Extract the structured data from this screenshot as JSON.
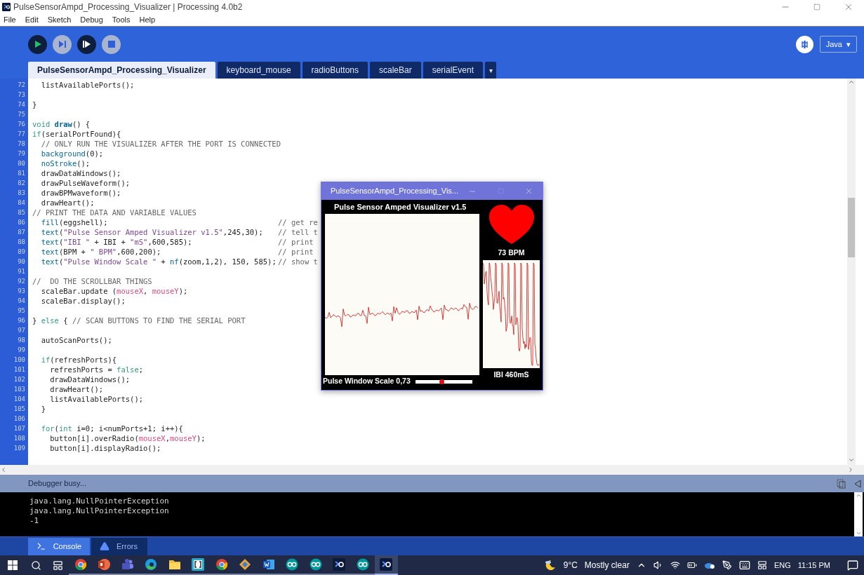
{
  "window": {
    "title": "PulseSensorAmpd_Processing_Visualizer | Processing 4.0b2"
  },
  "menu": [
    "File",
    "Edit",
    "Sketch",
    "Debug",
    "Tools",
    "Help"
  ],
  "toolbar": {
    "buttons": [
      {
        "kind": "run",
        "disabled": false
      },
      {
        "kind": "step",
        "disabled": true
      },
      {
        "kind": "continue",
        "disabled": false
      },
      {
        "kind": "stop",
        "disabled": true
      }
    ],
    "mode": {
      "label": "Java",
      "caret": "▾"
    }
  },
  "tabs": [
    {
      "label": "PulseSensorAmpd_Processing_Visualizer",
      "selected": true
    },
    {
      "label": "keyboard_mouse",
      "selected": false
    },
    {
      "label": "radioButtons",
      "selected": false
    },
    {
      "label": "scaleBar",
      "selected": false
    },
    {
      "label": "serialEvent",
      "selected": false
    }
  ],
  "tabs_menu": "▾",
  "editor": {
    "lines": [
      {
        "number": "72",
        "code": [
          {
            "text": "  listAvailablePorts();",
            "kind": "plain"
          }
        ]
      },
      {
        "number": "73"
      },
      {
        "number": "74",
        "code": [
          {
            "text": "}",
            "kind": "plain"
          }
        ]
      },
      {
        "number": "75"
      },
      {
        "number": "76",
        "code": [
          {
            "text": "void ",
            "kind": "keyword"
          },
          {
            "text": "draw",
            "kind": "bold"
          },
          {
            "text": "() {",
            "kind": "plain"
          }
        ]
      },
      {
        "number": "77",
        "code": [
          {
            "text": "if",
            "kind": "keyword"
          },
          {
            "text": "(serialPortFound){",
            "kind": "plain"
          }
        ]
      },
      {
        "number": "78",
        "code": [
          {
            "text": "  // ONLY RUN THE VISUALIZER AFTER THE PORT IS CONNECTED",
            "kind": "comment"
          }
        ]
      },
      {
        "number": "79",
        "code": [
          {
            "text": "  background",
            "kind": "function"
          },
          {
            "text": "(0);",
            "kind": "plain"
          }
        ]
      },
      {
        "number": "80",
        "code": [
          {
            "text": "  noStroke",
            "kind": "function"
          },
          {
            "text": "();",
            "kind": "plain"
          }
        ]
      },
      {
        "number": "81",
        "code": [
          {
            "text": "  drawDataWindows();",
            "kind": "plain"
          }
        ]
      },
      {
        "number": "82",
        "code": [
          {
            "text": "  drawPulseWaveform();",
            "kind": "plain"
          }
        ]
      },
      {
        "number": "83",
        "code": [
          {
            "text": "  drawBPMwaveform();",
            "kind": "plain"
          }
        ]
      },
      {
        "number": "84",
        "code": [
          {
            "text": "  drawHeart();",
            "kind": "plain"
          }
        ]
      },
      {
        "number": "85",
        "code": [
          {
            "text": "// PRINT THE DATA AND VARIABLE VALUES",
            "kind": "comment"
          }
        ]
      },
      {
        "number": "86",
        "code": [
          {
            "text": "  fill",
            "kind": "function"
          },
          {
            "text": "(eggshell);",
            "kind": "plain"
          }
        ],
        "note": "// get re"
      },
      {
        "number": "87",
        "code": [
          {
            "text": "  text",
            "kind": "function"
          },
          {
            "text": "(",
            "kind": "plain"
          },
          {
            "text": "\"Pulse Sensor Amped Visualizer v1.5\"",
            "kind": "string"
          },
          {
            "text": ",245,30);",
            "kind": "plain"
          }
        ],
        "note": "// tell t"
      },
      {
        "number": "88",
        "code": [
          {
            "text": "  text",
            "kind": "function"
          },
          {
            "text": "(",
            "kind": "plain"
          },
          {
            "text": "\"IBI \"",
            "kind": "string"
          },
          {
            "text": " + IBI + ",
            "kind": "plain"
          },
          {
            "text": "\"mS\"",
            "kind": "string"
          },
          {
            "text": ",600,585);",
            "kind": "plain"
          }
        ],
        "note": "// print"
      },
      {
        "number": "89",
        "code": [
          {
            "text": "  text",
            "kind": "function"
          },
          {
            "text": "(BPM + ",
            "kind": "plain"
          },
          {
            "text": "\" BPM\"",
            "kind": "string"
          },
          {
            "text": ",600,200);",
            "kind": "plain"
          }
        ],
        "note": "// print"
      },
      {
        "number": "90",
        "code": [
          {
            "text": "  text",
            "kind": "function"
          },
          {
            "text": "(",
            "kind": "plain"
          },
          {
            "text": "\"Pulse Window Scale \"",
            "kind": "string"
          },
          {
            "text": " + ",
            "kind": "plain"
          },
          {
            "text": "nf",
            "kind": "function"
          },
          {
            "text": "(zoom,1,2), 150, 585);",
            "kind": "plain"
          }
        ],
        "note": "// show t"
      },
      {
        "number": "91"
      },
      {
        "number": "92",
        "code": [
          {
            "text": "//  DO THE SCROLLBAR THINGS",
            "kind": "comment"
          }
        ]
      },
      {
        "number": "93",
        "code": [
          {
            "text": "  scaleBar.update (",
            "kind": "plain"
          },
          {
            "text": "mouseX",
            "kind": "variable"
          },
          {
            "text": ", ",
            "kind": "plain"
          },
          {
            "text": "mouseY",
            "kind": "variable"
          },
          {
            "text": ");",
            "kind": "plain"
          }
        ]
      },
      {
        "number": "94",
        "code": [
          {
            "text": "  scaleBar.display();",
            "kind": "plain"
          }
        ]
      },
      {
        "number": "95"
      },
      {
        "number": "96",
        "code": [
          {
            "text": "} ",
            "kind": "plain"
          },
          {
            "text": "else",
            "kind": "keyword"
          },
          {
            "text": " { ",
            "kind": "plain"
          },
          {
            "text": "// SCAN BUTTONS TO FIND THE SERIAL PORT",
            "kind": "comment"
          }
        ]
      },
      {
        "number": "97"
      },
      {
        "number": "98",
        "code": [
          {
            "text": "  autoScanPorts();",
            "kind": "plain"
          }
        ]
      },
      {
        "number": "99"
      },
      {
        "number": "100",
        "code": [
          {
            "text": "  if",
            "kind": "keyword"
          },
          {
            "text": "(refreshPorts){",
            "kind": "plain"
          }
        ]
      },
      {
        "number": "101",
        "code": [
          {
            "text": "    refreshPorts = ",
            "kind": "plain"
          },
          {
            "text": "false",
            "kind": "keyword"
          },
          {
            "text": ";",
            "kind": "plain"
          }
        ]
      },
      {
        "number": "102",
        "code": [
          {
            "text": "    drawDataWindows();",
            "kind": "plain"
          }
        ]
      },
      {
        "number": "103",
        "code": [
          {
            "text": "    drawHeart();",
            "kind": "plain"
          }
        ]
      },
      {
        "number": "104",
        "code": [
          {
            "text": "    listAvailablePorts();",
            "kind": "plain"
          }
        ]
      },
      {
        "number": "105",
        "code": [
          {
            "text": "  }",
            "kind": "plain"
          }
        ]
      },
      {
        "number": "106"
      },
      {
        "number": "107",
        "code": [
          {
            "text": "  for",
            "kind": "keyword"
          },
          {
            "text": "(",
            "kind": "plain"
          },
          {
            "text": "int",
            "kind": "keyword"
          },
          {
            "text": " i=0; i<numPorts+1; i++){",
            "kind": "plain"
          }
        ]
      },
      {
        "number": "108",
        "code": [
          {
            "text": "    button[i].overRadio(",
            "kind": "plain"
          },
          {
            "text": "mouseX",
            "kind": "variable"
          },
          {
            "text": ",",
            "kind": "plain"
          },
          {
            "text": "mouseY",
            "kind": "variable"
          },
          {
            "text": ");",
            "kind": "plain"
          }
        ]
      },
      {
        "number": "109",
        "code": [
          {
            "text": "    button[i].displayRadio();",
            "kind": "plain"
          }
        ]
      }
    ]
  },
  "sketch_window": {
    "title": "PulseSensorAmpd_Processing_Vis...",
    "heading": "Pulse Sensor Amped Visualizer v1.5",
    "bpm": "73 BPM",
    "scale_label": "Pulse Window Scale 0,73",
    "scale_slider": {
      "level": 0.46
    },
    "ibi": "IBI 460mS"
  },
  "status": "Debugger busy...",
  "console": {
    "lines": [
      "java.lang.NullPointerException",
      "java.lang.NullPointerException",
      "-1"
    ]
  },
  "console_tabs": [
    {
      "label": "Console",
      "kind": "console",
      "selected": true
    },
    {
      "label": "Errors",
      "kind": "errors",
      "selected": false
    }
  ],
  "taskbar": {
    "apps": [
      {
        "kind": "chrome",
        "active": false
      },
      {
        "kind": "powerpoint",
        "active": false
      },
      {
        "kind": "teams",
        "active": false
      },
      {
        "kind": "edge",
        "active": false
      },
      {
        "kind": "folder",
        "active": false
      },
      {
        "kind": "bracket",
        "active": false
      },
      {
        "kind": "chrome",
        "active": false
      },
      {
        "kind": "diamond",
        "active": false
      },
      {
        "kind": "word",
        "active": false
      },
      {
        "kind": "arduino",
        "active": false
      },
      {
        "kind": "arduino",
        "active": false
      },
      {
        "kind": "processing",
        "active": false
      },
      {
        "kind": "arduino",
        "active": false
      },
      {
        "kind": "processing",
        "active": true
      }
    ],
    "weather": {
      "temperature": "9°C",
      "condition": "Mostly clear"
    },
    "language": "ENG",
    "time": "11:15 PM"
  }
}
